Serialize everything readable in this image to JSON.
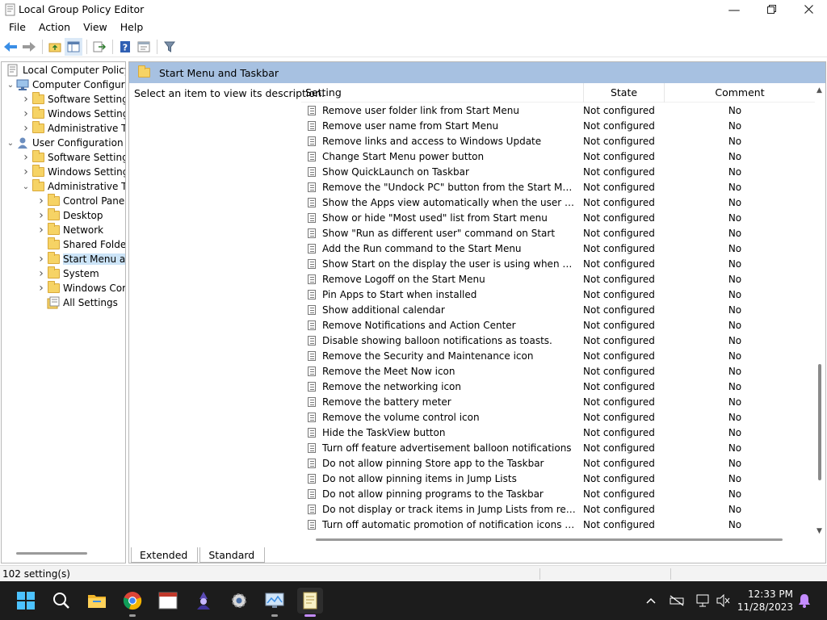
{
  "window": {
    "title": "Local Group Policy Editor"
  },
  "menu": [
    "File",
    "Action",
    "View",
    "Help"
  ],
  "tree": {
    "nodes": [
      {
        "label": "Local Computer Policy",
        "icon": "computer-policy-icon",
        "level": 0,
        "expander": ""
      },
      {
        "label": "Computer Configura",
        "icon": "computer-icon",
        "level": 1,
        "expander": "down"
      },
      {
        "label": "Software Settings",
        "icon": "folder-icon",
        "level": 2,
        "expander": "right"
      },
      {
        "label": "Windows Setting",
        "icon": "folder-icon",
        "level": 2,
        "expander": "right"
      },
      {
        "label": "Administrative Te",
        "icon": "folder-icon",
        "level": 2,
        "expander": "right"
      },
      {
        "label": "User Configuration",
        "icon": "user-icon",
        "level": 1,
        "expander": "down"
      },
      {
        "label": "Software Settings",
        "icon": "folder-icon",
        "level": 2,
        "expander": "right"
      },
      {
        "label": "Windows Setting",
        "icon": "folder-icon",
        "level": 2,
        "expander": "right"
      },
      {
        "label": "Administrative Te",
        "icon": "folder-icon",
        "level": 2,
        "expander": "down"
      },
      {
        "label": "Control Panel",
        "icon": "folder-icon",
        "level": 3,
        "expander": "right"
      },
      {
        "label": "Desktop",
        "icon": "folder-icon",
        "level": 3,
        "expander": "right"
      },
      {
        "label": "Network",
        "icon": "folder-icon",
        "level": 3,
        "expander": "right"
      },
      {
        "label": "Shared Folder",
        "icon": "folder-icon",
        "level": 3,
        "expander": ""
      },
      {
        "label": "Start Menu ar",
        "icon": "folder-icon",
        "level": 3,
        "expander": "right",
        "selected": true
      },
      {
        "label": "System",
        "icon": "folder-icon",
        "level": 3,
        "expander": "right"
      },
      {
        "label": "Windows Cor",
        "icon": "folder-icon",
        "level": 3,
        "expander": "right"
      },
      {
        "label": "All Settings",
        "icon": "all-settings-icon",
        "level": 3,
        "expander": ""
      }
    ]
  },
  "right": {
    "header": "Start Menu and Taskbar",
    "description": "Select an item to view its description.",
    "columns": {
      "setting": "Setting",
      "state": "State",
      "comment": "Comment"
    },
    "rows": [
      {
        "setting": "Remove user folder link from Start Menu",
        "state": "Not configured",
        "comment": "No"
      },
      {
        "setting": "Remove user name from Start Menu",
        "state": "Not configured",
        "comment": "No"
      },
      {
        "setting": "Remove links and access to Windows Update",
        "state": "Not configured",
        "comment": "No"
      },
      {
        "setting": "Change Start Menu power button",
        "state": "Not configured",
        "comment": "No"
      },
      {
        "setting": "Show QuickLaunch on Taskbar",
        "state": "Not configured",
        "comment": "No"
      },
      {
        "setting": "Remove the \"Undock PC\" button from the Start Menu",
        "state": "Not configured",
        "comment": "No"
      },
      {
        "setting": "Show the Apps view automatically when the user goes to St...",
        "state": "Not configured",
        "comment": "No"
      },
      {
        "setting": "Show or hide \"Most used\" list from Start menu",
        "state": "Not configured",
        "comment": "No"
      },
      {
        "setting": "Show \"Run as different user\" command on Start",
        "state": "Not configured",
        "comment": "No"
      },
      {
        "setting": "Add the Run command to the Start Menu",
        "state": "Not configured",
        "comment": "No"
      },
      {
        "setting": "Show Start on the display the user is using when they press t...",
        "state": "Not configured",
        "comment": "No"
      },
      {
        "setting": "Remove Logoff on the Start Menu",
        "state": "Not configured",
        "comment": "No"
      },
      {
        "setting": "Pin Apps to Start when installed",
        "state": "Not configured",
        "comment": "No"
      },
      {
        "setting": "Show additional calendar",
        "state": "Not configured",
        "comment": "No"
      },
      {
        "setting": "Remove Notifications and Action Center",
        "state": "Not configured",
        "comment": "No"
      },
      {
        "setting": "Disable showing balloon notifications as toasts.",
        "state": "Not configured",
        "comment": "No"
      },
      {
        "setting": "Remove the Security and Maintenance icon",
        "state": "Not configured",
        "comment": "No"
      },
      {
        "setting": "Remove the Meet Now icon",
        "state": "Not configured",
        "comment": "No"
      },
      {
        "setting": "Remove the networking icon",
        "state": "Not configured",
        "comment": "No"
      },
      {
        "setting": "Remove the battery meter",
        "state": "Not configured",
        "comment": "No"
      },
      {
        "setting": "Remove the volume control icon",
        "state": "Not configured",
        "comment": "No"
      },
      {
        "setting": "Hide the TaskView button",
        "state": "Not configured",
        "comment": "No"
      },
      {
        "setting": "Turn off feature advertisement balloon notifications",
        "state": "Not configured",
        "comment": "No"
      },
      {
        "setting": "Do not allow pinning Store app to the Taskbar",
        "state": "Not configured",
        "comment": "No"
      },
      {
        "setting": "Do not allow pinning items in Jump Lists",
        "state": "Not configured",
        "comment": "No"
      },
      {
        "setting": "Do not allow pinning programs to the Taskbar",
        "state": "Not configured",
        "comment": "No"
      },
      {
        "setting": "Do not display or track items in Jump Lists from remote loca...",
        "state": "Not configured",
        "comment": "No"
      },
      {
        "setting": "Turn off automatic promotion of notification icons to the ta...",
        "state": "Not configured",
        "comment": "No"
      }
    ],
    "tabs": [
      "Extended",
      "Standard"
    ]
  },
  "status": {
    "text": "102 setting(s)"
  },
  "taskbar": {
    "apps": [
      "start-icon",
      "search-icon",
      "file-explorer-icon",
      "chrome-icon",
      "window-app-icon",
      "wizard-app-icon",
      "network-gear-icon",
      "monitor-app-icon",
      "notepad-icon"
    ],
    "clock_time": "12:33 PM",
    "clock_date": "11/28/2023"
  },
  "colors": {
    "header_bg": "#a7c1e1",
    "selection": "#cce4f7",
    "taskbar_bg": "#1c1c1c",
    "accent": "#c48cff"
  }
}
